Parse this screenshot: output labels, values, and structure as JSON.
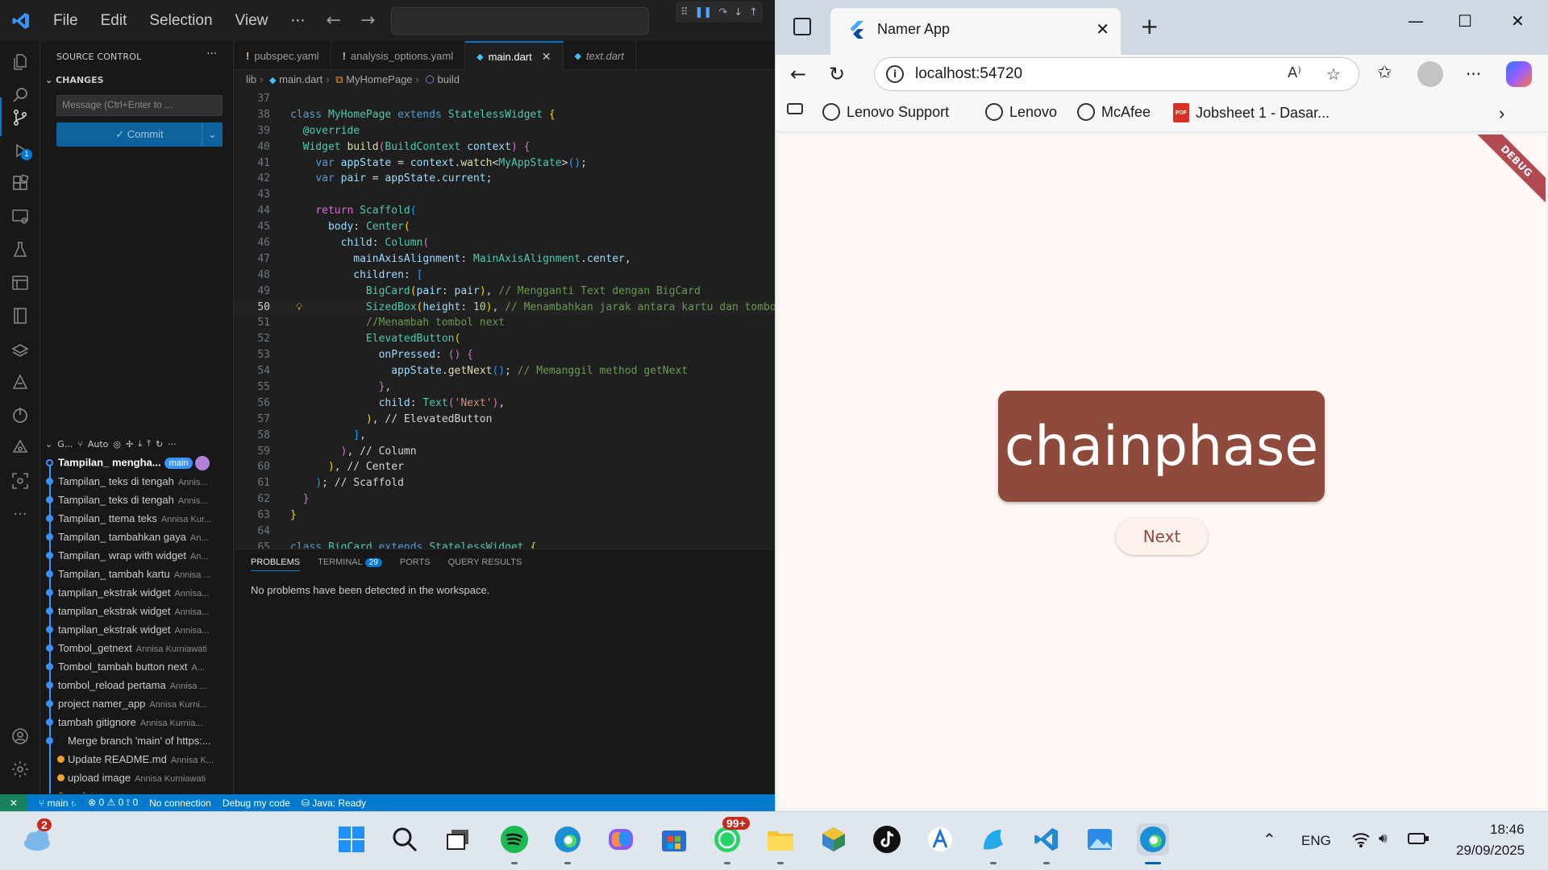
{
  "vscode": {
    "menu": [
      "File",
      "Edit",
      "Selection",
      "View"
    ],
    "menu_more": "···",
    "sidebar": {
      "header": "SOURCE CONTROL",
      "more": "···",
      "changes_label": "CHANGES",
      "commit_placeholder": "Message (Ctrl+Enter to ...",
      "commit_button": "✓ Commit",
      "graph_header": "G...",
      "graph_branch": "Auto",
      "commits": [
        {
          "message": "Tampilan_ mengha...",
          "author": "",
          "badge": "main",
          "head": true
        },
        {
          "message": "Tampilan_ teks di tengah",
          "author": "Annis..."
        },
        {
          "message": "Tampilan_ teks di tengah",
          "author": "Annis..."
        },
        {
          "message": "Tampilan_ ttema teks",
          "author": "Annisa Kur..."
        },
        {
          "message": "Tampilan_ tambahkan gaya",
          "author": "An..."
        },
        {
          "message": "Tampilan_ wrap with widget",
          "author": "An..."
        },
        {
          "message": "Tampilan_ tambah kartu",
          "author": "Annisa ..."
        },
        {
          "message": "tampilan_ekstrak widget",
          "author": "Annisa..."
        },
        {
          "message": "tampilan_ekstrak widget",
          "author": "Annisa..."
        },
        {
          "message": "tampilan_ekstrak widget",
          "author": "Annisa..."
        },
        {
          "message": "Tombol_getnext",
          "author": "Annisa Kurniawati"
        },
        {
          "message": "Tombol_tambah button next",
          "author": "A..."
        },
        {
          "message": "tombol_reload pertama",
          "author": "Annisa ..."
        },
        {
          "message": "project namer_app",
          "author": "Annisa Kurni..."
        },
        {
          "message": "tambah gitignore",
          "author": "Annisa Kurnia..."
        },
        {
          "message": "Merge branch 'main' of https:...",
          "author": "",
          "merge": true
        },
        {
          "message": "Update README.md",
          "author": "Annisa K...",
          "side": true
        },
        {
          "message": "upload image",
          "author": "Annisa Kurniawati",
          "side": true
        },
        {
          "message": "update",
          "author": "Annisa Kurniawati",
          "side": true
        }
      ]
    },
    "tabs": [
      {
        "label": "pubspec.yaml",
        "prefix": "!"
      },
      {
        "label": "analysis_options.yaml",
        "prefix": "!"
      },
      {
        "label": "main.dart",
        "prefix": "dart",
        "active": true
      },
      {
        "label": "text.dart",
        "prefix": "dart",
        "italic": true
      }
    ],
    "breadcrumb": [
      "lib",
      "main.dart",
      "MyHomePage",
      "build"
    ],
    "code_lines": [
      {
        "n": "37",
        "segs": []
      },
      {
        "n": "38",
        "segs": [
          [
            "k",
            "class "
          ],
          [
            "t",
            "MyHomePage "
          ],
          [
            "k",
            "extends "
          ],
          [
            "t",
            "StatelessWidget "
          ],
          [
            "y",
            "{"
          ]
        ]
      },
      {
        "n": "39",
        "segs": [
          [
            "p",
            "  "
          ],
          [
            "t",
            "@override"
          ]
        ]
      },
      {
        "n": "40",
        "segs": [
          [
            "p",
            "  "
          ],
          [
            "t",
            "Widget "
          ],
          [
            "f",
            "build"
          ],
          [
            "pk",
            "("
          ],
          [
            "t",
            "BuildContext "
          ],
          [
            "v",
            "context"
          ],
          [
            "pk",
            ")"
          ],
          [
            "p",
            " "
          ],
          [
            "pk",
            "{"
          ]
        ]
      },
      {
        "n": "41",
        "segs": [
          [
            "p",
            "    "
          ],
          [
            "k",
            "var "
          ],
          [
            "v",
            "appState "
          ],
          [
            "p",
            "= "
          ],
          [
            "v",
            "context"
          ],
          [
            "p",
            "."
          ],
          [
            "f",
            "watch"
          ],
          [
            "p",
            "<"
          ],
          [
            "t",
            "MyAppState"
          ],
          [
            "p",
            ">"
          ],
          [
            "bl",
            "()"
          ],
          [
            "p",
            ";"
          ]
        ]
      },
      {
        "n": "42",
        "segs": [
          [
            "p",
            "    "
          ],
          [
            "k",
            "var "
          ],
          [
            "v",
            "pair "
          ],
          [
            "p",
            "= "
          ],
          [
            "v",
            "appState"
          ],
          [
            "p",
            "."
          ],
          [
            "v",
            "current"
          ],
          [
            "p",
            ";"
          ]
        ]
      },
      {
        "n": "43",
        "segs": []
      },
      {
        "n": "44",
        "segs": [
          [
            "p",
            "    "
          ],
          [
            "pk",
            "return "
          ],
          [
            "t",
            "Scaffold"
          ],
          [
            "bl",
            "("
          ]
        ]
      },
      {
        "n": "45",
        "segs": [
          [
            "p",
            "      "
          ],
          [
            "v",
            "body"
          ],
          [
            "p",
            ": "
          ],
          [
            "t",
            "Center"
          ],
          [
            "y",
            "("
          ]
        ]
      },
      {
        "n": "46",
        "segs": [
          [
            "p",
            "        "
          ],
          [
            "v",
            "child"
          ],
          [
            "p",
            ": "
          ],
          [
            "t",
            "Column"
          ],
          [
            "pk",
            "("
          ]
        ]
      },
      {
        "n": "47",
        "segs": [
          [
            "p",
            "          "
          ],
          [
            "v",
            "mainAxisAlignment"
          ],
          [
            "p",
            ": "
          ],
          [
            "t",
            "MainAxisAlignment"
          ],
          [
            "p",
            "."
          ],
          [
            "v",
            "center"
          ],
          [
            "p",
            ","
          ]
        ]
      },
      {
        "n": "48",
        "segs": [
          [
            "p",
            "          "
          ],
          [
            "v",
            "children"
          ],
          [
            "p",
            ": "
          ],
          [
            "bl",
            "["
          ]
        ]
      },
      {
        "n": "49",
        "segs": [
          [
            "p",
            "            "
          ],
          [
            "t",
            "BigCard"
          ],
          [
            "y",
            "("
          ],
          [
            "v",
            "pair"
          ],
          [
            "p",
            ": "
          ],
          [
            "v",
            "pair"
          ],
          [
            "y",
            ")"
          ],
          [
            "p",
            ", "
          ],
          [
            "c",
            "// Mengganti Text dengan BigCard"
          ]
        ]
      },
      {
        "n": "50",
        "segs": [
          [
            "p",
            "            "
          ],
          [
            "t",
            "SizedBox"
          ],
          [
            "y",
            "("
          ],
          [
            "v",
            "height"
          ],
          [
            "p",
            ": "
          ],
          [
            "n",
            "10"
          ],
          [
            "y",
            ")"
          ],
          [
            "p",
            ", "
          ],
          [
            "c",
            "// Menambahkan jarak antara kartu dan tombol"
          ]
        ],
        "current": true
      },
      {
        "n": "51",
        "segs": [
          [
            "p",
            "            "
          ],
          [
            "c",
            "//Menambah tombol next"
          ]
        ]
      },
      {
        "n": "52",
        "segs": [
          [
            "p",
            "            "
          ],
          [
            "t",
            "ElevatedButton"
          ],
          [
            "y",
            "("
          ]
        ]
      },
      {
        "n": "53",
        "segs": [
          [
            "p",
            "              "
          ],
          [
            "v",
            "onPressed"
          ],
          [
            "p",
            ": "
          ],
          [
            "pk",
            "() "
          ],
          [
            "pk",
            "{"
          ]
        ]
      },
      {
        "n": "54",
        "segs": [
          [
            "p",
            "                "
          ],
          [
            "v",
            "appState"
          ],
          [
            "p",
            "."
          ],
          [
            "f",
            "getNext"
          ],
          [
            "bl",
            "()"
          ],
          [
            "p",
            "; "
          ],
          [
            "c",
            "// Memanggil method getNext"
          ]
        ]
      },
      {
        "n": "55",
        "segs": [
          [
            "p",
            "              "
          ],
          [
            "pk",
            "}"
          ],
          [
            "p",
            ","
          ]
        ]
      },
      {
        "n": "56",
        "segs": [
          [
            "p",
            "              "
          ],
          [
            "v",
            "child"
          ],
          [
            "p",
            ": "
          ],
          [
            "t",
            "Text"
          ],
          [
            "pk",
            "("
          ],
          [
            "s",
            "'Next'"
          ],
          [
            "pk",
            ")"
          ],
          [
            "p",
            ","
          ]
        ]
      },
      {
        "n": "57",
        "segs": [
          [
            "p",
            "            "
          ],
          [
            "y",
            ")"
          ],
          [
            "p",
            ", "
          ],
          [
            "p",
            "// ElevatedButton"
          ]
        ]
      },
      {
        "n": "58",
        "segs": [
          [
            "p",
            "          "
          ],
          [
            "bl",
            "]"
          ],
          [
            "p",
            ","
          ]
        ]
      },
      {
        "n": "59",
        "segs": [
          [
            "p",
            "        "
          ],
          [
            "pk",
            ")"
          ],
          [
            "p",
            ", "
          ],
          [
            "p",
            "// Column"
          ]
        ]
      },
      {
        "n": "60",
        "segs": [
          [
            "p",
            "      "
          ],
          [
            "y",
            ")"
          ],
          [
            "p",
            ", "
          ],
          [
            "p",
            "// Center"
          ]
        ]
      },
      {
        "n": "61",
        "segs": [
          [
            "p",
            "    "
          ],
          [
            "bl",
            ")"
          ],
          [
            "p",
            "; "
          ],
          [
            "p",
            "// Scaffold"
          ]
        ]
      },
      {
        "n": "62",
        "segs": [
          [
            "p",
            "  "
          ],
          [
            "pk",
            "}"
          ]
        ]
      },
      {
        "n": "63",
        "segs": [
          [
            "y",
            "}"
          ]
        ]
      },
      {
        "n": "64",
        "segs": []
      },
      {
        "n": "65",
        "segs": [
          [
            "k",
            "class "
          ],
          [
            "t",
            "BigCard "
          ],
          [
            "k",
            "extends "
          ],
          [
            "t",
            "StatelessWidget "
          ],
          [
            "y",
            "{"
          ]
        ]
      }
    ],
    "panel": {
      "tabs": [
        "PROBLEMS",
        "TERMINAL",
        "PORTS",
        "QUERY RESULTS"
      ],
      "terminal_count": "29",
      "message": "No problems have been detected in the workspace."
    },
    "status": {
      "branch": "main",
      "errors": "0",
      "warnings": "0",
      "ports": "0",
      "connection": "No connection",
      "debug": "Debug my code",
      "java": "Java: Ready"
    },
    "activity_badge": "1"
  },
  "browser": {
    "tab_title": "Namer App",
    "url": "localhost:54720",
    "favorites": [
      "Lenovo Support",
      "Lenovo",
      "McAfee",
      "Jobsheet 1 - Dasar..."
    ],
    "pdf_label": "PDF",
    "app": {
      "ribbon": "DEBUG",
      "word": "chainphase",
      "button": "Next"
    }
  },
  "taskbar": {
    "weather_badge": "2",
    "whatsapp_badge": "99+",
    "lang": "ENG",
    "time": "18:46",
    "date": "29/09/2025"
  },
  "colors": {
    "vscode_bg": "#1f1f1f",
    "accent": "#0078d4",
    "statusbar": "#007acc",
    "card": "#8e4b3b",
    "app_bg": "#fef7f5"
  }
}
